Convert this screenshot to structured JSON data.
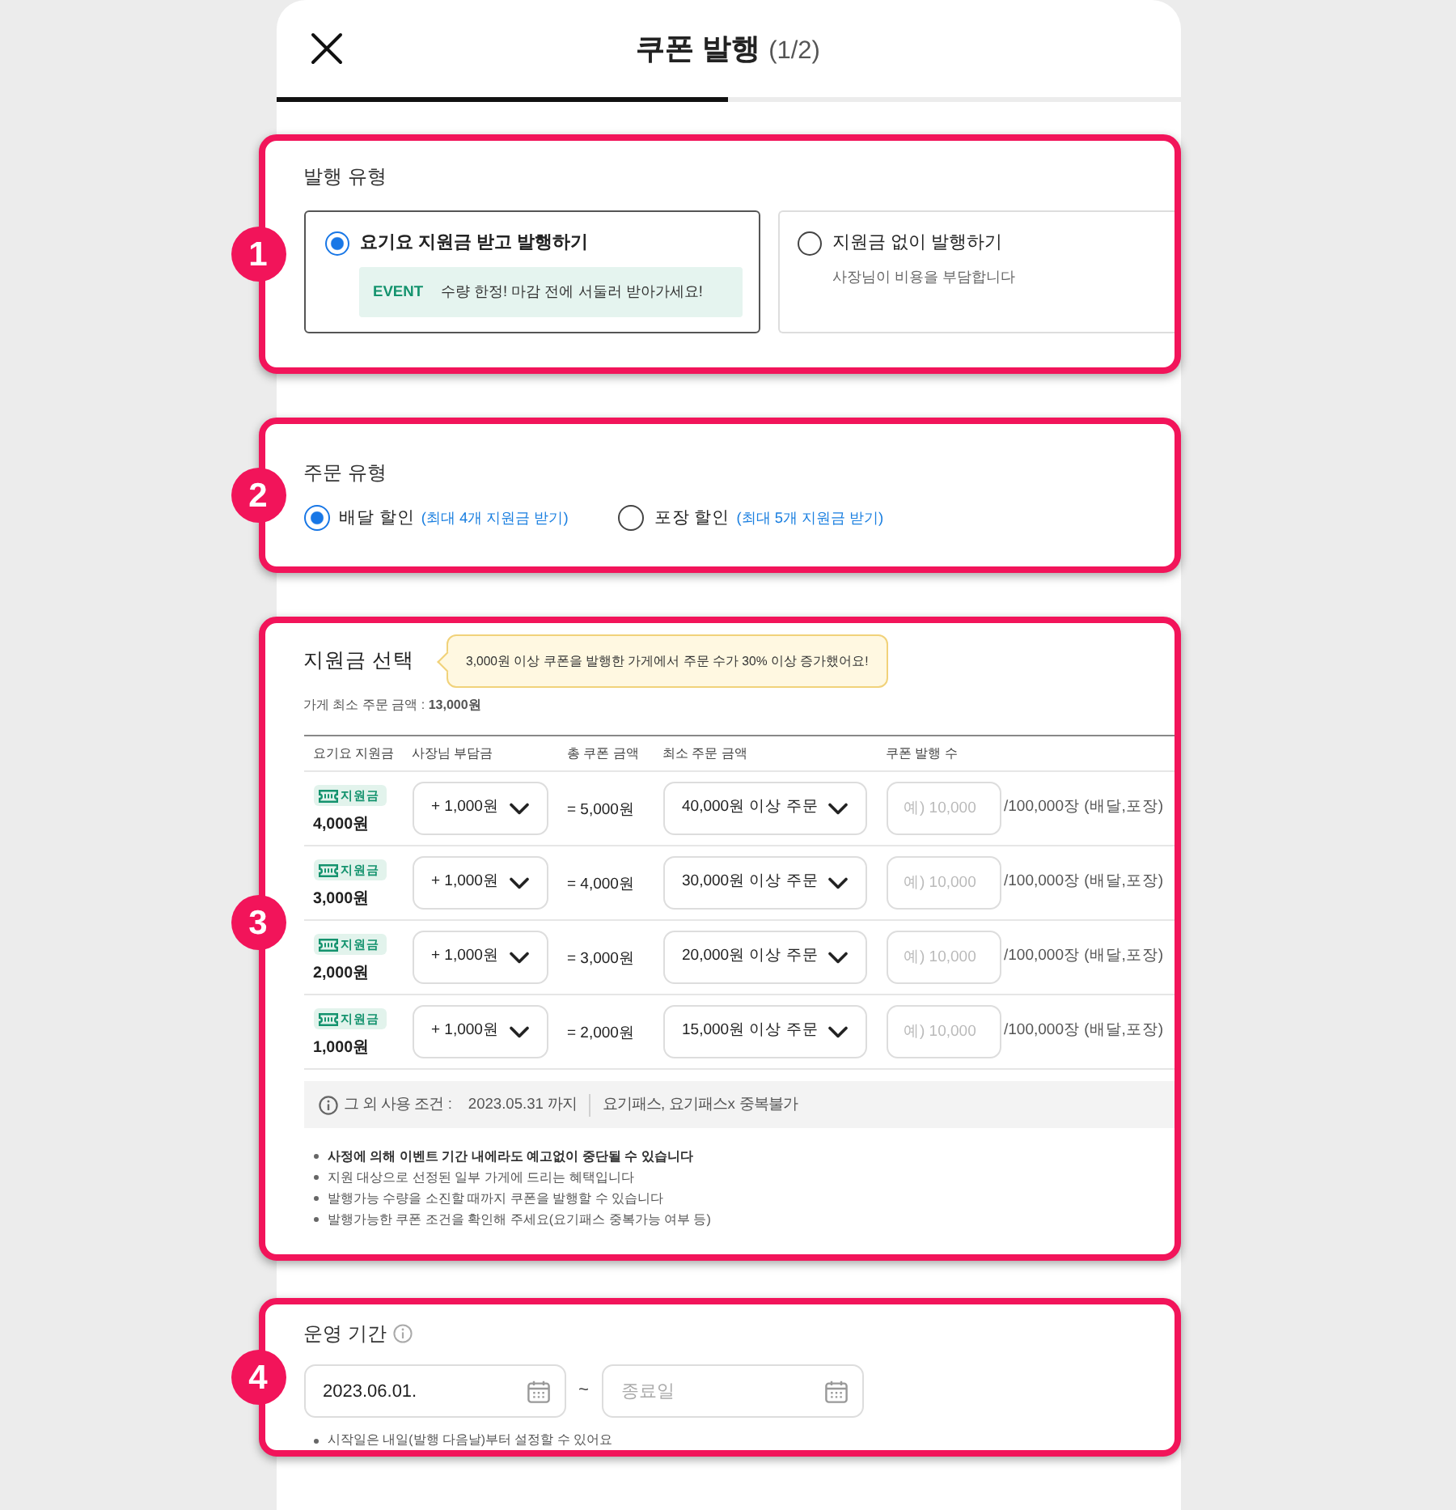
{
  "header": {
    "title": "쿠폰 발행",
    "step": "(1/2)",
    "progress": {
      "level": 0.5
    }
  },
  "issue_type": {
    "marker": "1",
    "title": "발행 유형",
    "options": [
      {
        "label": "요기요 지원금 받고 발행하기",
        "selected": true,
        "event": {
          "tag": "EVENT",
          "message": "수량 한정! 마감 전에 서둘러 받아가세요!"
        }
      },
      {
        "label": "지원금 없이 발행하기",
        "selected": false,
        "description": "사장님이 비용을 부담합니다"
      }
    ]
  },
  "order_type": {
    "marker": "2",
    "title": "주문 유형",
    "options": [
      {
        "label": "배달 할인",
        "note": "(최대 4개 지원금 받기)",
        "selected": true
      },
      {
        "label": "포장 할인",
        "note": "(최대 5개 지원금 받기)",
        "selected": false
      }
    ]
  },
  "subsidy": {
    "marker": "3",
    "title": "지원금 선택",
    "tip": "3,000원 이상 쿠폰을 발행한 가게에서 주문 수가 30% 이상 증가했어요!",
    "min_order": "가게 최소 주문 금액 : **13,000원**",
    "table": {
      "columns": [
        "요기요 지원금",
        "사장님 부담금",
        "총 쿠폰 금액",
        "최소 주문 금액",
        "쿠폰 발행 수"
      ],
      "rows": [
        {
          "tag": "지원금",
          "subsidy": "4,000원",
          "owner_share": "+ 1,000원",
          "total": "= 5,000원",
          "min_order": "40,000원 이상 주문",
          "count": {
            "placeholder": "예) 10,000"
          },
          "limit": "/100,000장 (배달,포장)"
        },
        {
          "tag": "지원금",
          "subsidy": "3,000원",
          "owner_share": "+ 1,000원",
          "total": "= 4,000원",
          "min_order": "30,000원 이상 주문",
          "count": {
            "placeholder": "예) 10,000"
          },
          "limit": "/100,000장 (배달,포장)"
        },
        {
          "tag": "지원금",
          "subsidy": "2,000원",
          "owner_share": "+ 1,000원",
          "total": "= 3,000원",
          "min_order": "20,000원 이상 주문",
          "count": {
            "placeholder": "예) 10,000"
          },
          "limit": "/100,000장 (배달,포장)"
        },
        {
          "tag": "지원금",
          "subsidy": "1,000원",
          "owner_share": "+ 1,000원",
          "total": "= 2,000원",
          "min_order": "15,000원 이상 주문",
          "count": {
            "placeholder": "예) 10,000"
          },
          "limit": "/100,000장 (배달,포장)"
        }
      ]
    },
    "conditions": {
      "label": "그 외 사용 조건 :",
      "items": [
        "2023.05.31 까지",
        "요기패스, 요기패스x 중복불가"
      ]
    },
    "notes": [
      {
        "text": "사정에 의해 이벤트 기간 내에라도 예고없이 중단될 수 있습니다",
        "emphasis": true
      },
      {
        "text": "지원 대상으로 선정된 일부 가게에 드리는 혜택입니다",
        "emphasis": false
      },
      {
        "text": "발행가능 수량을 소진할 때까지 쿠폰을 발행할 수 있습니다",
        "emphasis": false
      },
      {
        "text": "발행가능한 쿠폰 조건을 확인해 주세요(요기패스 중복가능 여부 등)",
        "emphasis": false
      }
    ]
  },
  "period": {
    "marker": "4",
    "title": "운영 기간",
    "start": {
      "value": "2023.06.01."
    },
    "separator": "~",
    "end": {
      "placeholder": "종료일"
    },
    "note": "시작일은 내일(발행 다음날)부터 설정할 수 있어요"
  }
}
